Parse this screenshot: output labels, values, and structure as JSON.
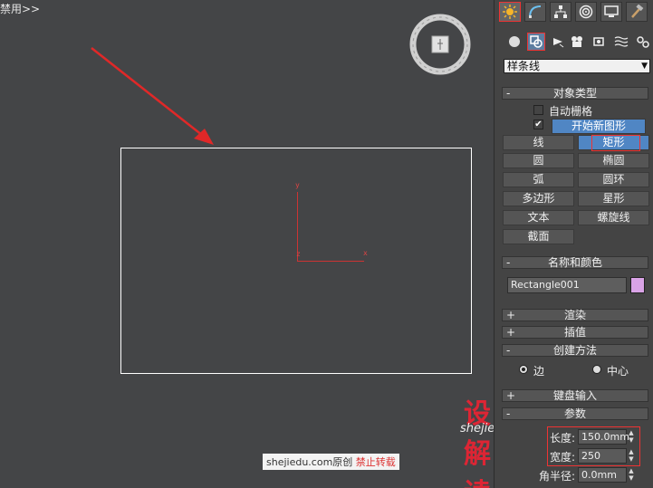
{
  "viewport": {
    "label": "禁用>>",
    "axes": {
      "y": "y",
      "x": "x",
      "z": "z"
    }
  },
  "watermark": {
    "site": "shejiedu.com",
    "original": "原创",
    "forbid": "禁止转载",
    "logo": "设解读",
    "url": "shejiedu.com"
  },
  "panel": {
    "tabs": [
      "create-icon",
      "modify-icon",
      "hierarchy-icon",
      "motion-icon",
      "display-icon",
      "utilities-icon"
    ],
    "subicons": [
      "geometry-icon",
      "shapes-icon",
      "lights-icon",
      "cameras-icon",
      "helpers-icon",
      "spacewarps-icon",
      "systems-icon"
    ],
    "category_dropdown": "样条线",
    "object_type": {
      "header": "对象类型",
      "auto_grid": "自动栅格",
      "start_new_shape": "开始新图形",
      "buttons": [
        "线",
        "矩形",
        "圆",
        "椭圆",
        "弧",
        "圆环",
        "多边形",
        "星形",
        "文本",
        "螺旋线",
        "截面"
      ]
    },
    "name_color": {
      "header": "名称和颜色",
      "name": "Rectangle001",
      "color": "#d9a3e6"
    },
    "rendering": "渲染",
    "interpolation": "插值",
    "creation_method": {
      "header": "创建方法",
      "edge": "边",
      "center": "中心"
    },
    "keyboard_entry": "键盘输入",
    "parameters": {
      "header": "参数",
      "length_label": "长度:",
      "length_value": "150.0mm",
      "width_label": "宽度:",
      "width_value": "250",
      "corner_radius_label": "角半径:",
      "corner_radius_value": "0.0mm"
    }
  }
}
